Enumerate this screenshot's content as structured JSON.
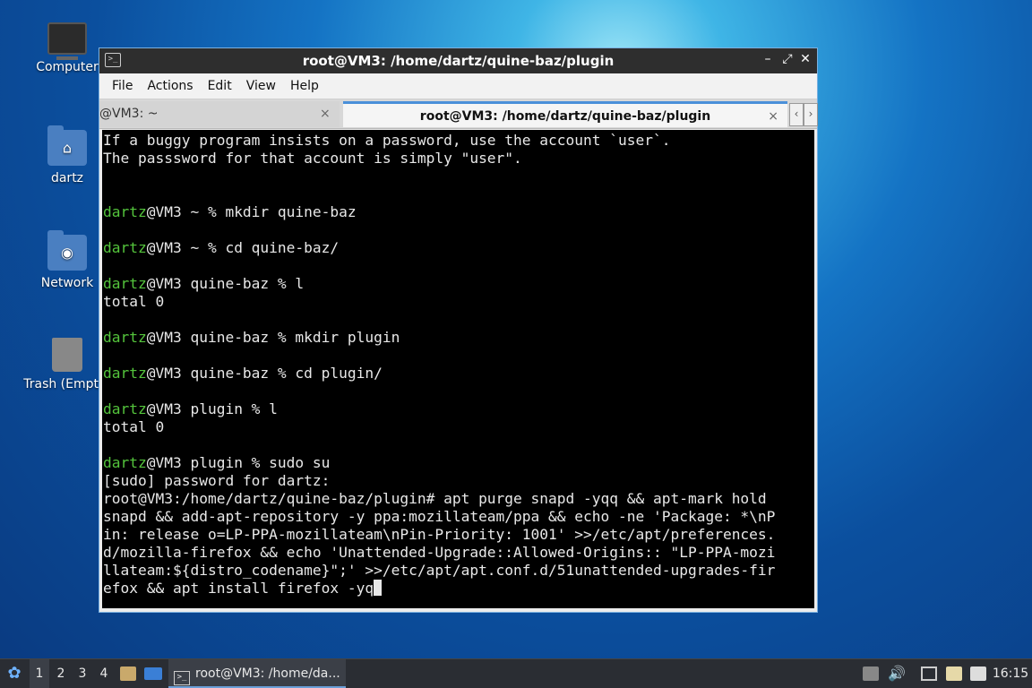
{
  "desktop": {
    "icons": [
      {
        "label": "Computer"
      },
      {
        "label": "dartz"
      },
      {
        "label": "Network"
      },
      {
        "label": "Trash (Empty)"
      }
    ]
  },
  "window": {
    "title": "root@VM3: /home/dartz/quine-baz/plugin",
    "titlebar_icon": ">_",
    "controls": {
      "minimize": "–",
      "maximize": "⤢",
      "close": "✕"
    },
    "menu": [
      "File",
      "Actions",
      "Edit",
      "View",
      "Help"
    ],
    "tabs": [
      {
        "label": "@VM3: ~",
        "close": "×"
      },
      {
        "label": "root@VM3: /home/dartz/quine-baz/plugin",
        "close": "×"
      }
    ],
    "tab_nav": {
      "left": "‹",
      "right": "›"
    }
  },
  "terminal": {
    "prompt_user": "dartz",
    "lines": [
      {
        "text": "If a buggy program insists on a password, use the account `user`."
      },
      {
        "text": "The passsword for that account is simply \"user\"."
      },
      {
        "text": ""
      },
      {
        "text": ""
      },
      {
        "prompt": "dartz",
        "text": "@VM3 ~ % mkdir quine-baz"
      },
      {
        "text": ""
      },
      {
        "prompt": "dartz",
        "text": "@VM3 ~ % cd quine-baz/"
      },
      {
        "text": ""
      },
      {
        "prompt": "dartz",
        "text": "@VM3 quine-baz % l"
      },
      {
        "text": "total 0"
      },
      {
        "text": ""
      },
      {
        "prompt": "dartz",
        "text": "@VM3 quine-baz % mkdir plugin"
      },
      {
        "text": ""
      },
      {
        "prompt": "dartz",
        "text": "@VM3 quine-baz % cd plugin/"
      },
      {
        "text": ""
      },
      {
        "prompt": "dartz",
        "text": "@VM3 plugin % l"
      },
      {
        "text": "total 0"
      },
      {
        "text": ""
      },
      {
        "prompt": "dartz",
        "text": "@VM3 plugin % sudo su"
      },
      {
        "text": "[sudo] password for dartz:"
      },
      {
        "text": "root@VM3:/home/dartz/quine-baz/plugin# apt purge snapd -yqq && apt-mark hold"
      },
      {
        "text": "snapd && add-apt-repository -y ppa:mozillateam/ppa && echo -ne 'Package: *\\nP"
      },
      {
        "text": "in: release o=LP-PPA-mozillateam\\nPin-Priority: 1001' >>/etc/apt/preferences."
      },
      {
        "text": "d/mozilla-firefox && echo 'Unattended-Upgrade::Allowed-Origins:: \"LP-PPA-mozi"
      },
      {
        "text": "llateam:${distro_codename}\";' >>/etc/apt/apt.conf.d/51unattended-upgrades-fir"
      },
      {
        "text": "efox && apt install firefox -yq",
        "cursor": true
      }
    ]
  },
  "taskbar": {
    "start_icon": "✿",
    "workspaces": [
      "1",
      "2",
      "3",
      "4"
    ],
    "task_label": "root@VM3: /home/da...",
    "clock": "16:15",
    "tray_icons": [
      "upload-icon",
      "volume-icon",
      "network-icon",
      "clipboard-icon",
      "notification-icon"
    ]
  },
  "colors": {
    "prompt_green": "#54c43c",
    "terminal_bg": "#000000",
    "tab_accent": "#4a90d9"
  }
}
